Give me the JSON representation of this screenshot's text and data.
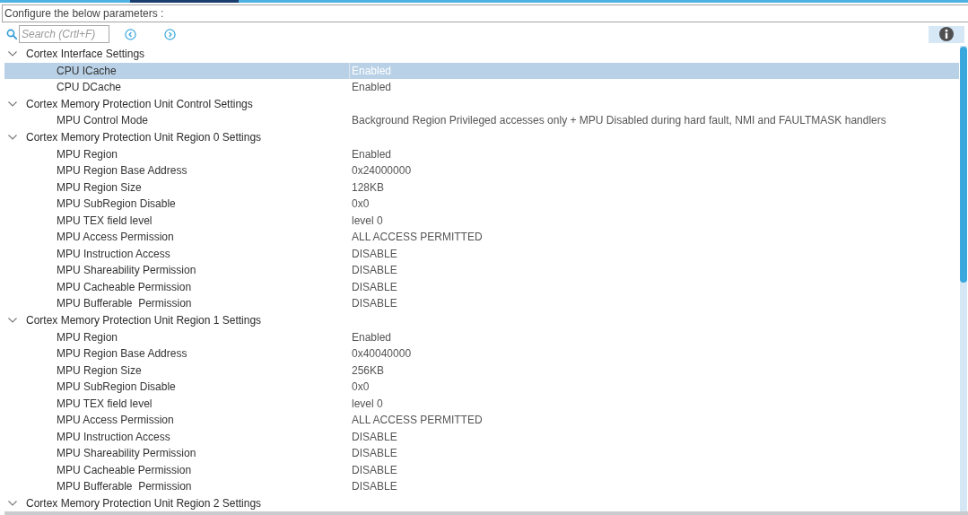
{
  "header": "Configure the below parameters :",
  "search": {
    "placeholder": "Search (Crtl+F)"
  },
  "tree": [
    {
      "label": "Cortex Interface Settings",
      "expanded": true,
      "children": [
        {
          "label": "CPU ICache",
          "value": "Enabled",
          "selected": true
        },
        {
          "label": "CPU DCache",
          "value": "Enabled",
          "selected": false
        }
      ]
    },
    {
      "label": "Cortex Memory Protection Unit Control Settings",
      "expanded": true,
      "children": [
        {
          "label": "MPU Control Mode",
          "value": "Background Region Privileged accesses only + MPU Disabled during hard fault, NMI and FAULTMASK handlers",
          "selected": false
        }
      ]
    },
    {
      "label": "Cortex Memory Protection Unit Region 0 Settings",
      "expanded": true,
      "children": [
        {
          "label": "MPU Region",
          "value": "Enabled",
          "selected": false
        },
        {
          "label": "MPU Region Base Address",
          "value": "0x24000000",
          "selected": false
        },
        {
          "label": "MPU Region Size",
          "value": "128KB",
          "selected": false
        },
        {
          "label": "MPU SubRegion Disable",
          "value": "0x0",
          "selected": false
        },
        {
          "label": "MPU TEX field level",
          "value": "level 0",
          "selected": false
        },
        {
          "label": "MPU Access Permission",
          "value": "ALL ACCESS PERMITTED",
          "selected": false
        },
        {
          "label": "MPU Instruction Access",
          "value": "DISABLE",
          "selected": false
        },
        {
          "label": "MPU Shareability Permission",
          "value": "DISABLE",
          "selected": false
        },
        {
          "label": "MPU Cacheable Permission",
          "value": "DISABLE",
          "selected": false
        },
        {
          "label": "MPU Bufferable  Permission",
          "value": "DISABLE",
          "selected": false
        }
      ]
    },
    {
      "label": "Cortex Memory Protection Unit Region 1 Settings",
      "expanded": true,
      "children": [
        {
          "label": "MPU Region",
          "value": "Enabled",
          "selected": false
        },
        {
          "label": "MPU Region Base Address",
          "value": "0x40040000",
          "selected": false
        },
        {
          "label": "MPU Region Size",
          "value": "256KB",
          "selected": false
        },
        {
          "label": "MPU SubRegion Disable",
          "value": "0x0",
          "selected": false
        },
        {
          "label": "MPU TEX field level",
          "value": "level 0",
          "selected": false
        },
        {
          "label": "MPU Access Permission",
          "value": "ALL ACCESS PERMITTED",
          "selected": false
        },
        {
          "label": "MPU Instruction Access",
          "value": "DISABLE",
          "selected": false
        },
        {
          "label": "MPU Shareability Permission",
          "value": "DISABLE",
          "selected": false
        },
        {
          "label": "MPU Cacheable Permission",
          "value": "DISABLE",
          "selected": false
        },
        {
          "label": "MPU Bufferable  Permission",
          "value": "DISABLE",
          "selected": false
        }
      ]
    },
    {
      "label": "Cortex Memory Protection Unit Region 2 Settings",
      "expanded": true
    }
  ]
}
